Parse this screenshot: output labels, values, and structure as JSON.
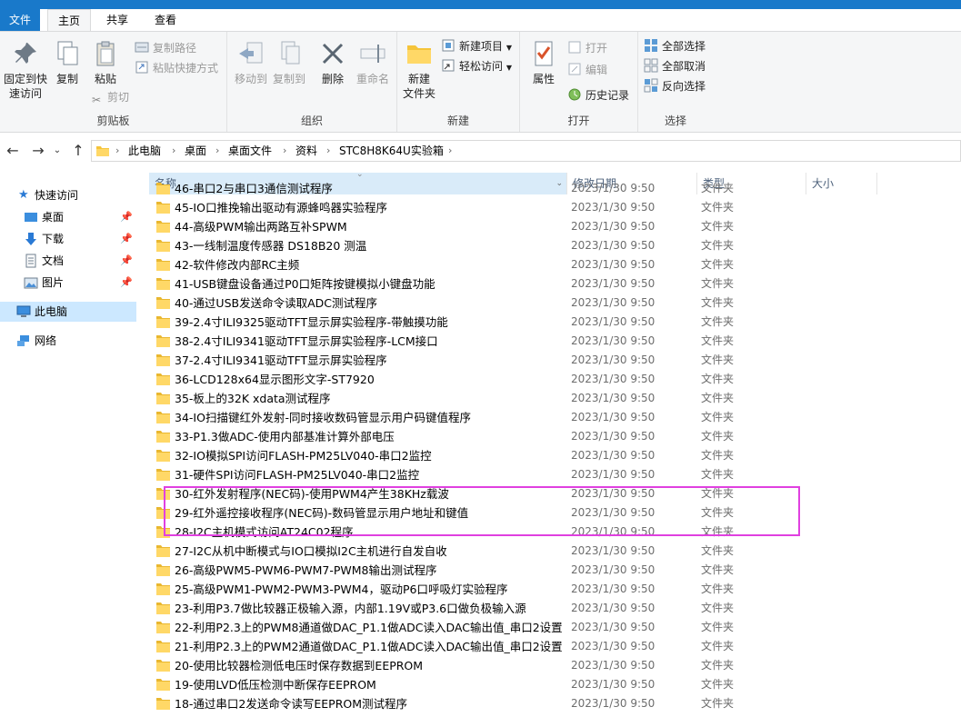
{
  "ribbon_tabs": [
    "文件",
    "主页",
    "共享",
    "查看"
  ],
  "ribbon": {
    "clipboard": {
      "pin_label_1": "固定到快",
      "pin_label_2": "速访问",
      "copy": "复制",
      "paste": "粘贴",
      "copy_path": "复制路径",
      "paste_shortcut": "粘贴快捷方式",
      "cut": "剪切",
      "group": "剪贴板"
    },
    "organize": {
      "move_to": "移动到",
      "copy_to": "复制到",
      "delete": "删除",
      "rename": "重命名",
      "group": "组织"
    },
    "new": {
      "new_folder_1": "新建",
      "new_folder_2": "文件夹",
      "new_item": "新建项目",
      "easy_access": "轻松访问",
      "group": "新建"
    },
    "open": {
      "properties": "属性",
      "open": "打开",
      "edit": "编辑",
      "history": "历史记录",
      "group": "打开"
    },
    "select": {
      "select_all": "全部选择",
      "select_none": "全部取消",
      "invert": "反向选择",
      "group": "选择"
    }
  },
  "breadcrumbs": [
    "此电脑",
    "桌面",
    "桌面文件",
    "资料",
    "STC8H8K64U实验箱"
  ],
  "nav": {
    "quick_access": "快速访问",
    "desktop": "桌面",
    "downloads": "下载",
    "documents": "文档",
    "pictures": "图片",
    "this_pc": "此电脑",
    "network": "网络"
  },
  "columns": {
    "name": "名称",
    "date": "修改日期",
    "type": "类型",
    "size": "大小"
  },
  "files": [
    {
      "name": "46-串口2与串口3通信测试程序",
      "date": "2023/1/30 9:50",
      "type": "文件夹"
    },
    {
      "name": "45-IO口推挽输出驱动有源蜂鸣器实验程序",
      "date": "2023/1/30 9:50",
      "type": "文件夹"
    },
    {
      "name": "44-高级PWM输出两路互补SPWM",
      "date": "2023/1/30 9:50",
      "type": "文件夹"
    },
    {
      "name": "43-一线制温度传感器 DS18B20 测温",
      "date": "2023/1/30 9:50",
      "type": "文件夹"
    },
    {
      "name": "42-软件修改内部RC主频",
      "date": "2023/1/30 9:50",
      "type": "文件夹"
    },
    {
      "name": "41-USB键盘设备通过P0口矩阵按键模拟小键盘功能",
      "date": "2023/1/30 9:50",
      "type": "文件夹"
    },
    {
      "name": "40-通过USB发送命令读取ADC测试程序",
      "date": "2023/1/30 9:50",
      "type": "文件夹"
    },
    {
      "name": "39-2.4寸ILI9325驱动TFT显示屏实验程序-带触摸功能",
      "date": "2023/1/30 9:50",
      "type": "文件夹"
    },
    {
      "name": "38-2.4寸ILI9341驱动TFT显示屏实验程序-LCM接口",
      "date": "2023/1/30 9:50",
      "type": "文件夹"
    },
    {
      "name": "37-2.4寸ILI9341驱动TFT显示屏实验程序",
      "date": "2023/1/30 9:50",
      "type": "文件夹"
    },
    {
      "name": "36-LCD128x64显示图形文字-ST7920",
      "date": "2023/1/30 9:50",
      "type": "文件夹"
    },
    {
      "name": "35-板上的32K xdata测试程序",
      "date": "2023/1/30 9:50",
      "type": "文件夹"
    },
    {
      "name": "34-IO扫描键红外发射-同时接收数码管显示用户码键值程序",
      "date": "2023/1/30 9:50",
      "type": "文件夹"
    },
    {
      "name": "33-P1.3做ADC-使用内部基准计算外部电压",
      "date": "2023/1/30 9:50",
      "type": "文件夹"
    },
    {
      "name": "32-IO模拟SPI访问FLASH-PM25LV040-串口2监控",
      "date": "2023/1/30 9:50",
      "type": "文件夹"
    },
    {
      "name": "31-硬件SPI访问FLASH-PM25LV040-串口2监控",
      "date": "2023/1/30 9:50",
      "type": "文件夹"
    },
    {
      "name": "30-红外发射程序(NEC码)-使用PWM4产生38KHz载波",
      "date": "2023/1/30 9:50",
      "type": "文件夹"
    },
    {
      "name": "29-红外遥控接收程序(NEC码)-数码管显示用户地址和键值",
      "date": "2023/1/30 9:50",
      "type": "文件夹"
    },
    {
      "name": "28-I2C主机模式访问AT24C02程序",
      "date": "2023/1/30 9:50",
      "type": "文件夹"
    },
    {
      "name": "27-I2C从机中断模式与IO口模拟I2C主机进行自发自收",
      "date": "2023/1/30 9:50",
      "type": "文件夹"
    },
    {
      "name": "26-高级PWM5-PWM6-PWM7-PWM8输出测试程序",
      "date": "2023/1/30 9:50",
      "type": "文件夹"
    },
    {
      "name": "25-高级PWM1-PWM2-PWM3-PWM4，驱动P6口呼吸灯实验程序",
      "date": "2023/1/30 9:50",
      "type": "文件夹"
    },
    {
      "name": "23-利用P3.7做比较器正极输入源，内部1.19V或P3.6口做负极输入源",
      "date": "2023/1/30 9:50",
      "type": "文件夹"
    },
    {
      "name": "22-利用P2.3上的PWM8通道做DAC_P1.1做ADC读入DAC输出值_串口2设置占...",
      "date": "2023/1/30 9:50",
      "type": "文件夹"
    },
    {
      "name": "21-利用P2.3上的PWM2通道做DAC_P1.1做ADC读入DAC输出值_串口2设置占...",
      "date": "2023/1/30 9:50",
      "type": "文件夹"
    },
    {
      "name": "20-使用比较器检测低电压时保存数据到EEPROM",
      "date": "2023/1/30 9:50",
      "type": "文件夹"
    },
    {
      "name": "19-使用LVD低压检测中断保存EEPROM",
      "date": "2023/1/30 9:50",
      "type": "文件夹"
    },
    {
      "name": "18-通过串口2发送命令读写EEPROM测试程序",
      "date": "2023/1/30 9:50",
      "type": "文件夹"
    }
  ]
}
